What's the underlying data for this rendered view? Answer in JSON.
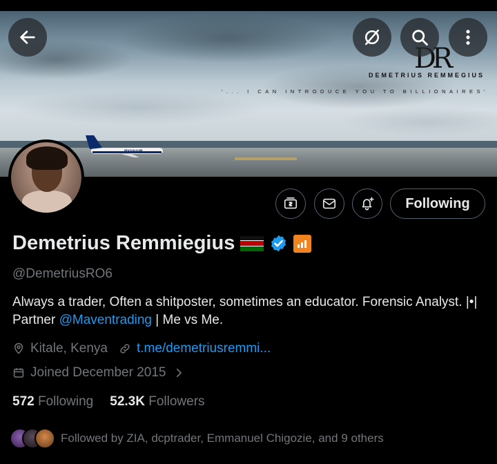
{
  "banner": {
    "logo_text": "DR",
    "brand_name": "DEMETRIUS REMMEGIUS",
    "tagline": "'... I CAN INTRODUCE YOU TO BILLIONAIRES'",
    "plane_livery": "RYANAIR"
  },
  "header_buttons": {
    "back_icon": "arrow-left-icon",
    "grok_icon": "grok-slash-icon",
    "search_icon": "search-icon",
    "more_icon": "more-vertical-icon"
  },
  "profile": {
    "name": "Demetrius Remmiegius",
    "flag": "kenya-flag",
    "verified": true,
    "handle": "@DemetriusRO6",
    "bio_part1": "Always a trader, Often a shitposter, sometimes an educator. Forensic Analyst. |•| Partner ",
    "bio_mention": "@Maventrading",
    "bio_part2": " |  Me vs Me.",
    "location": "Kitale, Kenya",
    "link": "t.me/demetriusremmi...",
    "joined": "Joined December 2015"
  },
  "actions": {
    "subscribe_icon": "subscription-icon",
    "message_icon": "envelope-icon",
    "notify_icon": "bell-plus-icon",
    "follow_label": "Following"
  },
  "stats": {
    "following_count": "572",
    "following_label": "Following",
    "followers_count": "52.3K",
    "followers_label": "Followers"
  },
  "followed_by": {
    "text": "Followed by ZIA, dcptrader, Emmanuel Chigozie, and 9 others"
  },
  "colors": {
    "accent": "#1d9bf0",
    "muted": "#71767b",
    "text": "#e7e9ea",
    "border": "#536471"
  }
}
